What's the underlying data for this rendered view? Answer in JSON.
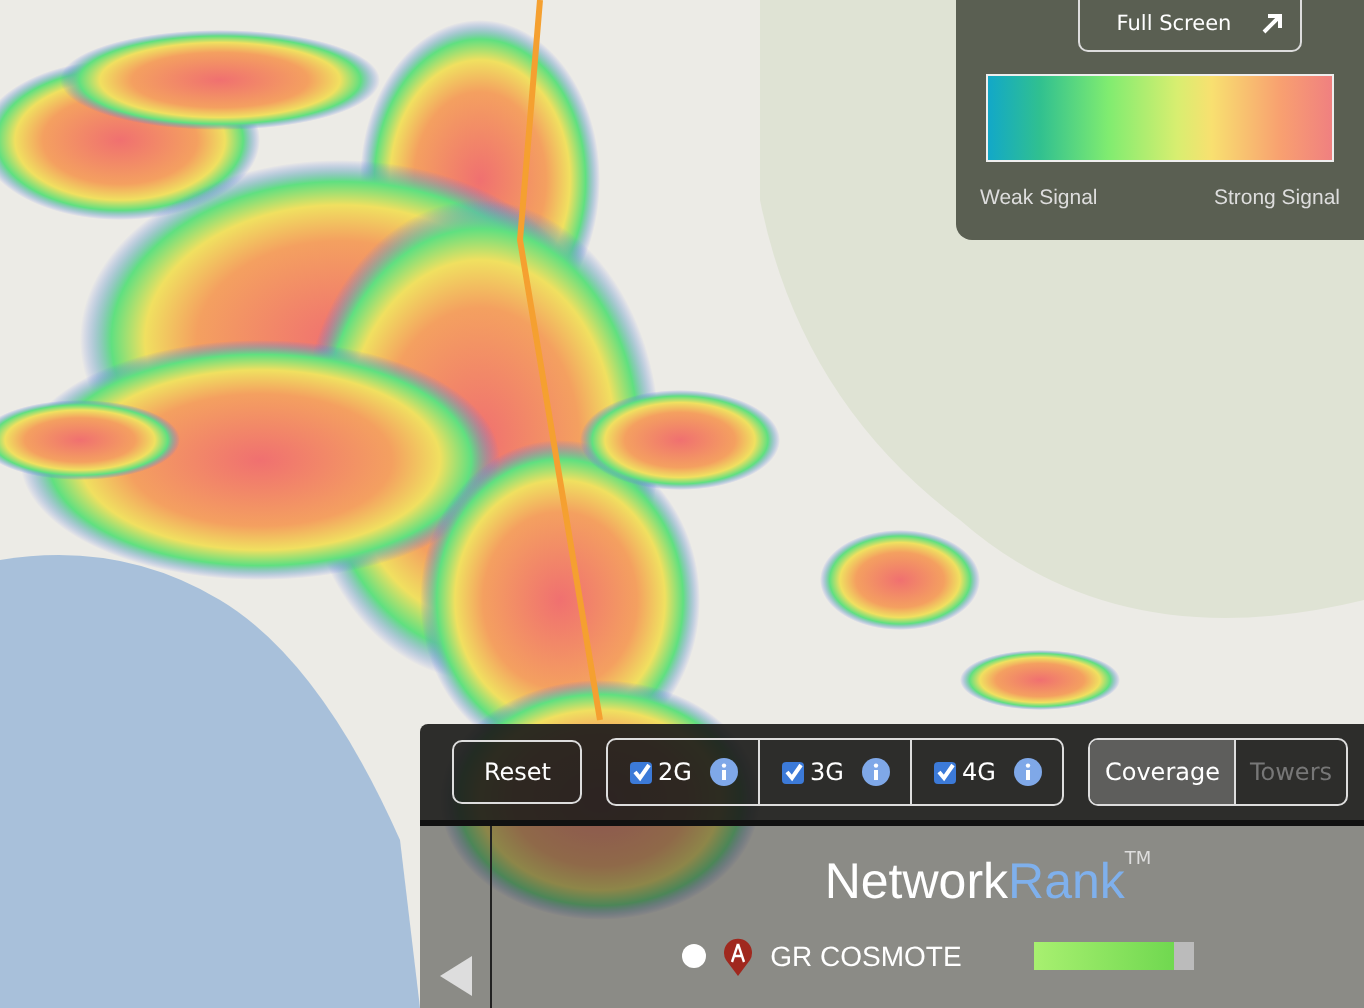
{
  "legend": {
    "full_screen_button": "Full Screen",
    "weak_label": "Weak Signal",
    "strong_label": "Strong Signal"
  },
  "toolbar": {
    "reset_button": "Reset",
    "networks": [
      {
        "label": "2G",
        "checked": true
      },
      {
        "label": "3G",
        "checked": true
      },
      {
        "label": "4G",
        "checked": true
      }
    ],
    "view_tabs": [
      {
        "label": "Coverage",
        "selected": true
      },
      {
        "label": "Towers",
        "selected": false
      }
    ]
  },
  "brand": {
    "name": "Network",
    "name_accent": "Rank",
    "trademark": "TM"
  },
  "operator": {
    "name": "GR COSMOTE",
    "selected": false,
    "level": 0.88
  }
}
